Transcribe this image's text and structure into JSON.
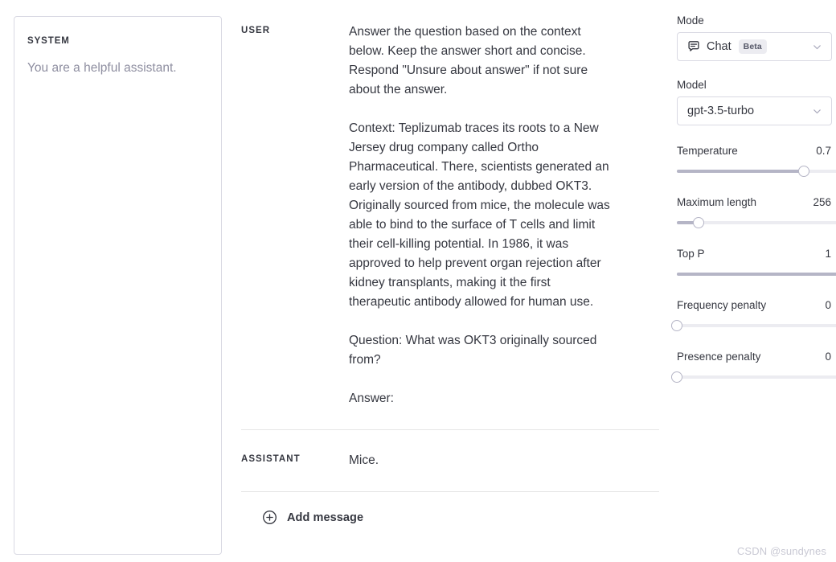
{
  "system": {
    "label": "SYSTEM",
    "text": "You are a helpful assistant."
  },
  "conversation": {
    "messages": [
      {
        "role": "USER",
        "text": "Answer the question based on the context below. Keep the answer short and concise. Respond \"Unsure about answer\" if not sure about the answer.\n\nContext: Teplizumab traces its roots to a New Jersey drug company called Ortho Pharmaceutical. There, scientists generated an early version of the antibody, dubbed OKT3. Originally sourced from mice, the molecule was able to bind to the surface of T cells and limit their cell-killing potential. In 1986, it was approved to help prevent organ rejection after kidney transplants, making it the first therapeutic antibody allowed for human use.\n\nQuestion: What was OKT3 originally sourced from?\n\nAnswer:"
      },
      {
        "role": "ASSISTANT",
        "text": "Mice."
      }
    ],
    "add_message_label": "Add message",
    "add_message_icon": "plus-circle-icon"
  },
  "params": {
    "mode": {
      "label": "Mode",
      "value": "Chat",
      "badge": "Beta",
      "icon": "chat-bubble-icon",
      "chevron_icon": "chevron-down-icon"
    },
    "model": {
      "label": "Model",
      "value": "gpt-3.5-turbo",
      "chevron_icon": "chevron-down-icon"
    },
    "sliders": [
      {
        "name": "Temperature",
        "value": "0.7",
        "percent": 70
      },
      {
        "name": "Maximum length",
        "value": "256",
        "percent": 12
      },
      {
        "name": "Top P",
        "value": "1",
        "percent": 100
      },
      {
        "name": "Frequency penalty",
        "value": "0",
        "percent": 0
      },
      {
        "name": "Presence penalty",
        "value": "0",
        "percent": 0
      }
    ]
  },
  "watermark": "CSDN @sundynes",
  "colors": {
    "text": "#353740",
    "muted": "#8e8ea0",
    "border": "#d9d9e3",
    "track": "#ececf1",
    "fill": "#b5b5c6",
    "watermark": "#c9c9d4"
  }
}
